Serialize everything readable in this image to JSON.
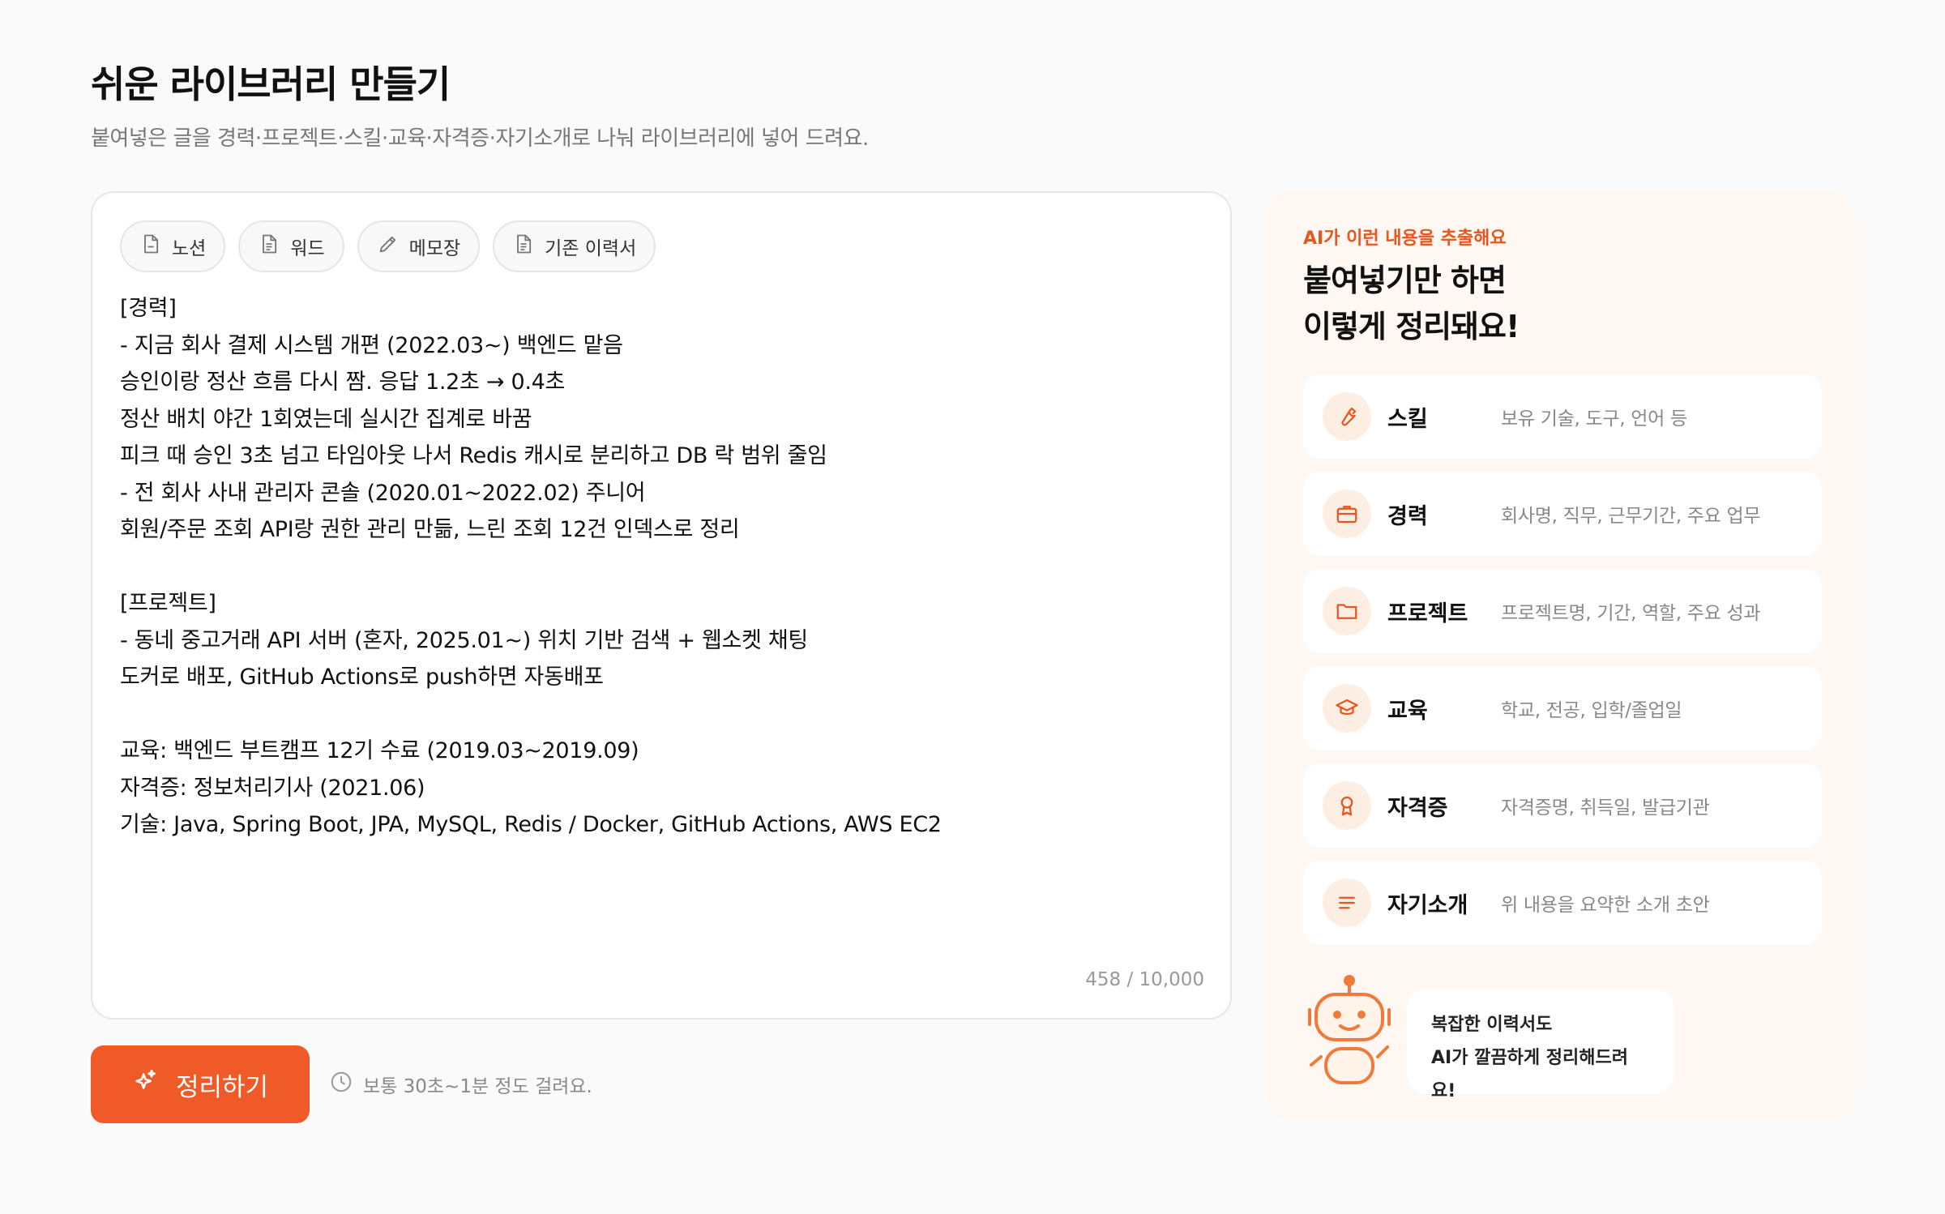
{
  "page": {
    "title": "쉬운 라이브러리 만들기",
    "subtitle": "붙여넣은 글을 경력·프로젝트·스킬·교육·자격증·자기소개로 나눠 라이브러리에 넣어 드려요."
  },
  "sources": [
    {
      "label": "노션",
      "icon": "document-icon"
    },
    {
      "label": "워드",
      "icon": "document-lines-icon"
    },
    {
      "label": "메모장",
      "icon": "pencil-icon"
    },
    {
      "label": "기존 이력서",
      "icon": "document-lines-icon"
    }
  ],
  "editor": {
    "lines": [
      "[경력]",
      "- 지금 회사 결제 시스템 개편 (2022.03~) 백엔드 맡음",
      "승인이랑 정산 흐름 다시 짬. 응답 1.2초 → 0.4초",
      "정산 배치 야간 1회였는데 실시간 집계로 바꿈",
      "피크 때 승인 3초 넘고 타임아웃 나서 Redis 캐시로 분리하고 DB 락 범위 줄임",
      "- 전 회사 사내 관리자 콘솔 (2020.01~2022.02) 주니어",
      "회원/주문 조회 API랑 권한 관리 만듦, 느린 조회 12건 인덱스로 정리",
      "",
      "[프로젝트]",
      "- 동네 중고거래 API 서버 (혼자, 2025.01~) 위치 기반 검색 + 웹소켓 채팅",
      "도커로 배포, GitHub Actions로 push하면 자동배포",
      "",
      "교육: 백엔드 부트캠프 12기 수료 (2019.03~2019.09)",
      "자격증: 정보처리기사 (2021.06)",
      "기술: Java, Spring Boot, JPA, MySQL, Redis / Docker, GitHub Actions, AWS EC2"
    ],
    "char_count": "458 / 10,000"
  },
  "actions": {
    "submit_label": "정리하기",
    "hint": "보통 30초~1분 정도 걸려요."
  },
  "panel": {
    "eyebrow": "AI가 이런 내용을 추출해요",
    "title_line1": "붙여넣기만 하면",
    "title_line2": "이렇게 정리돼요!",
    "categories": [
      {
        "name": "스킬",
        "desc": "보유 기술, 도구, 언어 등",
        "icon": "wrench-icon"
      },
      {
        "name": "경력",
        "desc": "회사명, 직무, 근무기간, 주요 업무",
        "icon": "briefcase-icon"
      },
      {
        "name": "프로젝트",
        "desc": "프로젝트명, 기간, 역할, 주요 성과",
        "icon": "folder-icon"
      },
      {
        "name": "교육",
        "desc": "학교, 전공, 입학/졸업일",
        "icon": "graduation-cap-icon"
      },
      {
        "name": "자격증",
        "desc": "자격증명, 취득일, 발급기관",
        "icon": "award-icon"
      },
      {
        "name": "자기소개",
        "desc": "위 내용을 요약한 소개 초안",
        "icon": "text-lines-icon"
      }
    ],
    "bubble_line1": "복잡한 이력서도",
    "bubble_line2": "AI가 깔끔하게 정리해드려요!"
  },
  "colors": {
    "accent": "#f05a28",
    "panel_bg": "#fff7f1",
    "icon_bg": "#fdeee4"
  }
}
